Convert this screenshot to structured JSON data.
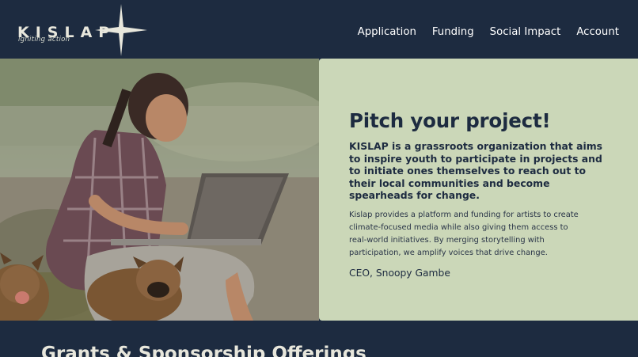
{
  "brand": {
    "name": "KISLAP",
    "tagline": "igniting action",
    "logo_icon": "four-point-star-icon",
    "colors": {
      "navy": "#1d2b40",
      "sage": "#cbd7b8",
      "cream": "#e8e7dc"
    }
  },
  "nav": {
    "items": [
      {
        "label": "Application"
      },
      {
        "label": "Funding"
      },
      {
        "label": "Social Impact"
      },
      {
        "label": "Account"
      }
    ]
  },
  "hero": {
    "title": "Pitch your project!",
    "lead": "KISLAP is a grassroots organization that aims to inspire youth to participate in projects and to initiate ones themselves to reach out to their local communities and become spearheads for change.",
    "body": "Kislap provides a platform and funding for artists to create climate-focused media while also giving them access to real-world initiatives. By merging storytelling with participation, we amplify voices that drive change.",
    "signature": "CEO, Snoopy Gambe"
  },
  "offerings": {
    "title": "Grants & Sponsorship Offerings"
  }
}
